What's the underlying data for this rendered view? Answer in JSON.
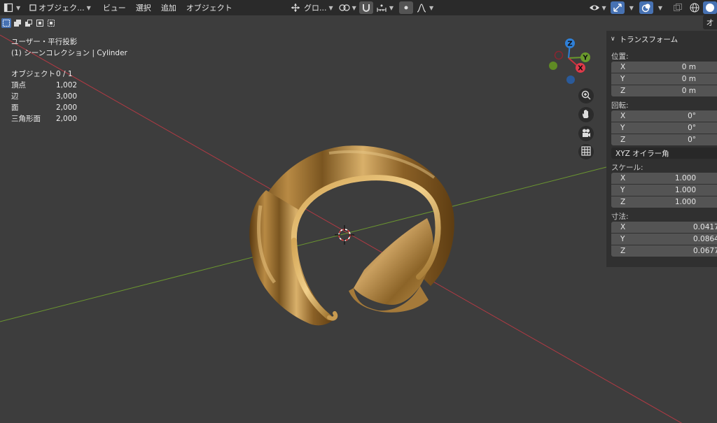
{
  "header": {
    "mode_label": "オブジェク...",
    "menu": [
      "ビュー",
      "選択",
      "追加",
      "オブジェクト"
    ],
    "transform_orientation": "グロ..."
  },
  "right_tab_label": "オ",
  "overlay": {
    "view_name": "ユーザー・平行投影",
    "collection": "(1) シーンコレクション | Cylinder",
    "stats": [
      {
        "label": "オブジェクト",
        "value": "0 / 1"
      },
      {
        "label": "頂点",
        "value": "1,002"
      },
      {
        "label": "辺",
        "value": "3,000"
      },
      {
        "label": "面",
        "value": "2,000"
      },
      {
        "label": "三角形面",
        "value": "2,000"
      }
    ]
  },
  "gizmo": {
    "x": "X",
    "y": "Y",
    "z": "Z"
  },
  "panel": {
    "title": "トランスフォーム",
    "location": {
      "label": "位置:",
      "rows": [
        {
          "axis": "X",
          "value": "0 m"
        },
        {
          "axis": "Y",
          "value": "0 m"
        },
        {
          "axis": "Z",
          "value": "0 m"
        }
      ]
    },
    "rotation": {
      "label": "回転:",
      "rows": [
        {
          "axis": "X",
          "value": "0°"
        },
        {
          "axis": "Y",
          "value": "0°"
        },
        {
          "axis": "Z",
          "value": "0°"
        }
      ]
    },
    "rotation_mode": "XYZ オイラー角",
    "scale": {
      "label": "スケール:",
      "rows": [
        {
          "axis": "X",
          "value": "1.000"
        },
        {
          "axis": "Y",
          "value": "1.000"
        },
        {
          "axis": "Z",
          "value": "1.000"
        }
      ]
    },
    "dimensions": {
      "label": "寸法:",
      "rows": [
        {
          "axis": "X",
          "value": "0.0417"
        },
        {
          "axis": "Y",
          "value": "0.0864"
        },
        {
          "axis": "Z",
          "value": "0.0677"
        }
      ]
    }
  },
  "colors": {
    "background": "#3d3d3d",
    "header": "#2a2a2a",
    "x_axis": "#c8313e",
    "y_axis": "#6a9a2c",
    "z_axis": "#2f80d8",
    "accent": "#4772b3",
    "gold": "#b8873a"
  }
}
